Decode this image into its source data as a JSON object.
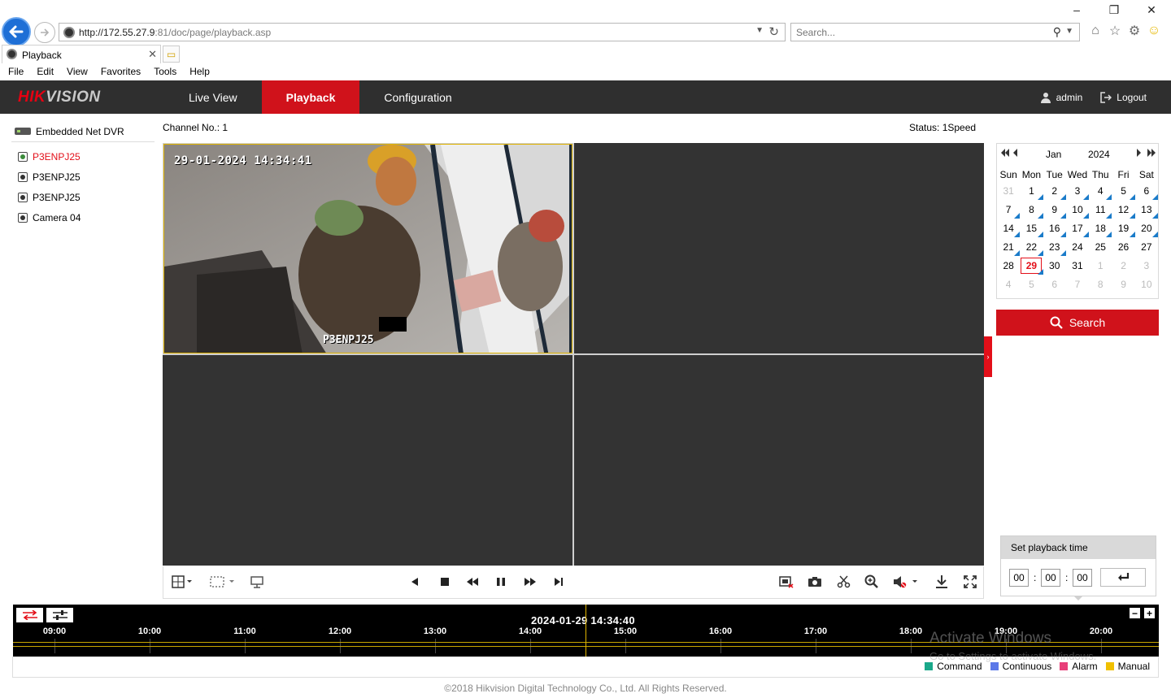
{
  "browser": {
    "url_host": "http://172.55.27.9",
    "url_rest": ":81/doc/page/playback.asp",
    "search_placeholder": "Search...",
    "tab_title": "Playback",
    "menu": [
      "File",
      "Edit",
      "View",
      "Favorites",
      "Tools",
      "Help"
    ]
  },
  "header": {
    "logo_red": "HIK",
    "logo_grey": "VISION",
    "nav": [
      "Live View",
      "Playback",
      "Configuration"
    ],
    "active_nav": "Playback",
    "user": "admin",
    "logout": "Logout"
  },
  "tree": {
    "root": "Embedded Net DVR",
    "cameras": [
      "P3ENPJ25",
      "P3ENPJ25",
      "P3ENPJ25",
      "Camera 04"
    ],
    "selected_index": 0
  },
  "video": {
    "channel_label": "Channel No.: 1",
    "status_label": "Status: 1Speed",
    "osd_timestamp": "29-01-2024 14:34:41",
    "osd_name": "P3ENPJ25"
  },
  "calendar": {
    "month": "Jan",
    "year": "2024",
    "weekdays": [
      "Sun",
      "Mon",
      "Tue",
      "Wed",
      "Thu",
      "Fri",
      "Sat"
    ],
    "weeks": [
      [
        {
          "d": "31",
          "other": true
        },
        {
          "d": "1",
          "rec": true
        },
        {
          "d": "2",
          "rec": true
        },
        {
          "d": "3",
          "rec": true
        },
        {
          "d": "4",
          "rec": true
        },
        {
          "d": "5",
          "rec": true
        },
        {
          "d": "6",
          "rec": true
        }
      ],
      [
        {
          "d": "7",
          "rec": true
        },
        {
          "d": "8",
          "rec": true
        },
        {
          "d": "9",
          "rec": true
        },
        {
          "d": "10",
          "rec": true
        },
        {
          "d": "11",
          "rec": true
        },
        {
          "d": "12",
          "rec": true
        },
        {
          "d": "13",
          "rec": true
        }
      ],
      [
        {
          "d": "14",
          "rec": true
        },
        {
          "d": "15",
          "rec": true
        },
        {
          "d": "16",
          "rec": true
        },
        {
          "d": "17",
          "rec": true
        },
        {
          "d": "18",
          "rec": true
        },
        {
          "d": "19",
          "rec": true
        },
        {
          "d": "20",
          "rec": true
        }
      ],
      [
        {
          "d": "21",
          "rec": true
        },
        {
          "d": "22",
          "rec": true
        },
        {
          "d": "23",
          "rec": true
        },
        {
          "d": "24"
        },
        {
          "d": "25"
        },
        {
          "d": "26"
        },
        {
          "d": "27"
        }
      ],
      [
        {
          "d": "28"
        },
        {
          "d": "29",
          "today": true,
          "rec": true
        },
        {
          "d": "30"
        },
        {
          "d": "31"
        },
        {
          "d": "1",
          "other": true
        },
        {
          "d": "2",
          "other": true
        },
        {
          "d": "3",
          "other": true
        }
      ],
      [
        {
          "d": "4",
          "other": true
        },
        {
          "d": "5",
          "other": true
        },
        {
          "d": "6",
          "other": true
        },
        {
          "d": "7",
          "other": true
        },
        {
          "d": "8",
          "other": true
        },
        {
          "d": "9",
          "other": true
        },
        {
          "d": "10",
          "other": true
        }
      ]
    ],
    "search_label": "Search"
  },
  "playback_time": {
    "title": "Set playback time",
    "hh": "00",
    "mm": "00",
    "ss": "00"
  },
  "timeline": {
    "current": "2024-01-29 14:34:40",
    "hours": [
      "09:00",
      "10:00",
      "11:00",
      "12:00",
      "13:00",
      "14:00",
      "15:00",
      "16:00",
      "17:00",
      "18:00",
      "19:00",
      "20:00"
    ]
  },
  "legend": [
    {
      "label": "Command",
      "color": "#1aa88a"
    },
    {
      "label": "Continuous",
      "color": "#5b78e8"
    },
    {
      "label": "Alarm",
      "color": "#e8407a"
    },
    {
      "label": "Manual",
      "color": "#f0c000"
    }
  ],
  "watermark": {
    "line1": "Activate Windows",
    "line2": "Go to Settings to activate Windows."
  },
  "footer": "©2018 Hikvision Digital Technology Co., Ltd. All Rights Reserved.",
  "colors": {
    "brand_red": "#d0121b",
    "header_bg": "#2f2f2f",
    "record_blue": "#1a7bc9"
  }
}
